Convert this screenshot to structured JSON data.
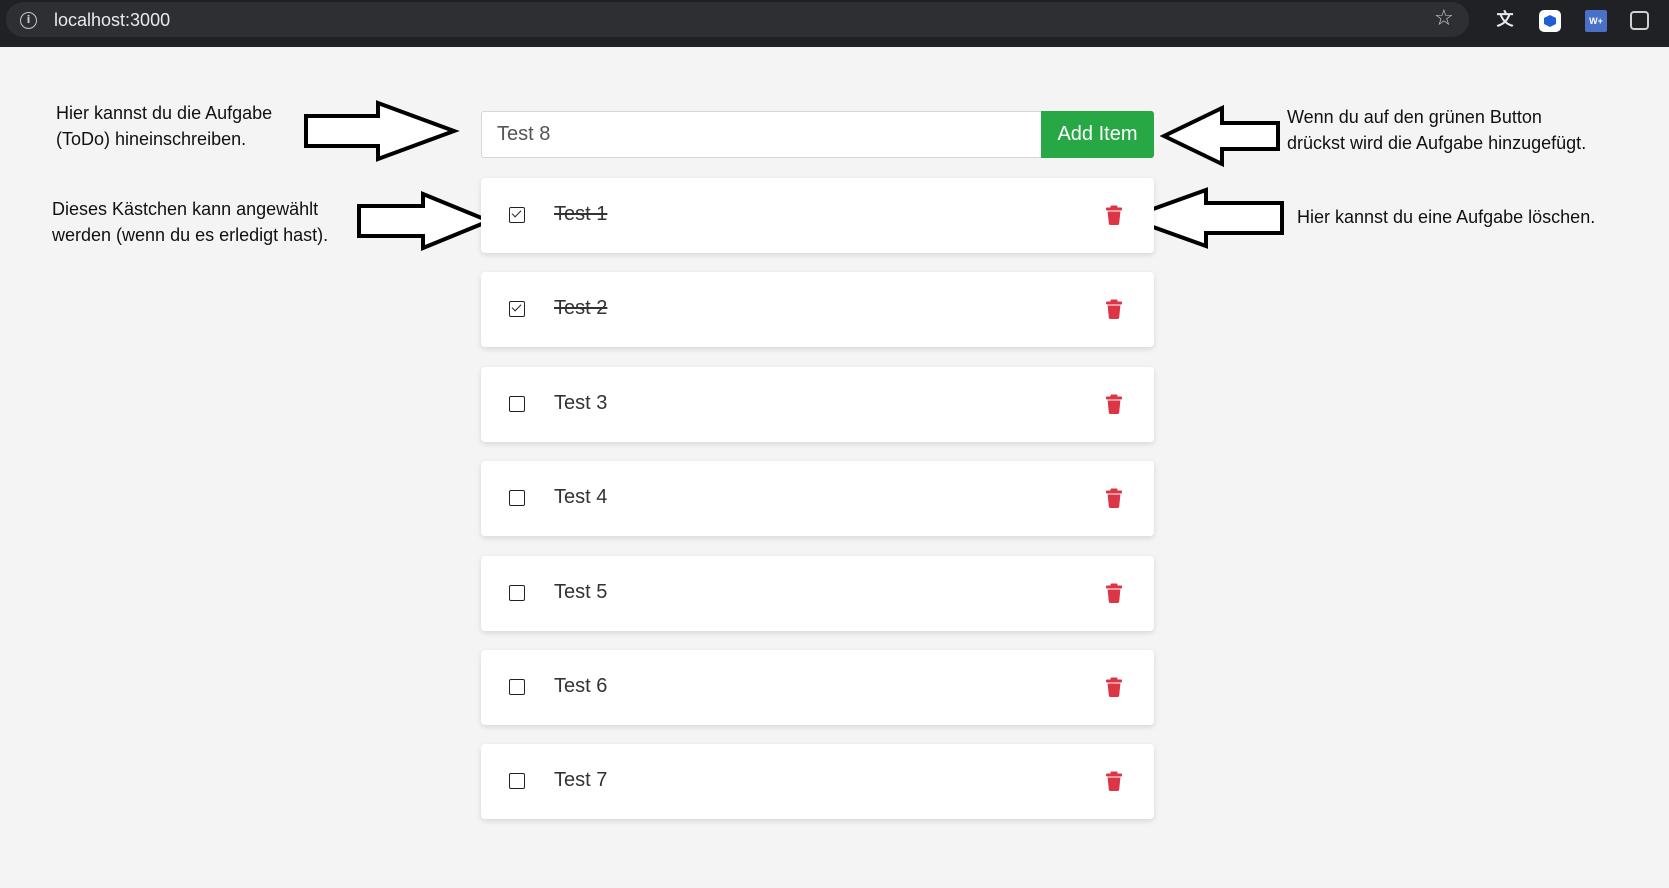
{
  "browser": {
    "url": "localhost:3000",
    "extension_translate_label": "文"
  },
  "annotations": {
    "input_hint": [
      "Hier kannst du die Aufgabe",
      "(ToDo) hineinschreiben."
    ],
    "button_hint": [
      "Wenn du auf den grünen Button",
      "drückst wird die Aufgabe hinzugefügt."
    ],
    "checkbox_hint": [
      "Dieses Kästchen kann angewählt",
      "werden (wenn du es erledigt hast)."
    ],
    "delete_hint": [
      "Hier kannst du eine Aufgabe löschen."
    ]
  },
  "form": {
    "input_value": "Test 8",
    "add_button_label": "Add Item",
    "add_button_color": "#28a745"
  },
  "colors": {
    "delete_icon": "#dc3545"
  },
  "todos": [
    {
      "text": "Test 1",
      "done": true
    },
    {
      "text": "Test 2",
      "done": true
    },
    {
      "text": "Test 3",
      "done": false
    },
    {
      "text": "Test 4",
      "done": false
    },
    {
      "text": "Test 5",
      "done": false
    },
    {
      "text": "Test 6",
      "done": false
    },
    {
      "text": "Test 7",
      "done": false
    }
  ]
}
